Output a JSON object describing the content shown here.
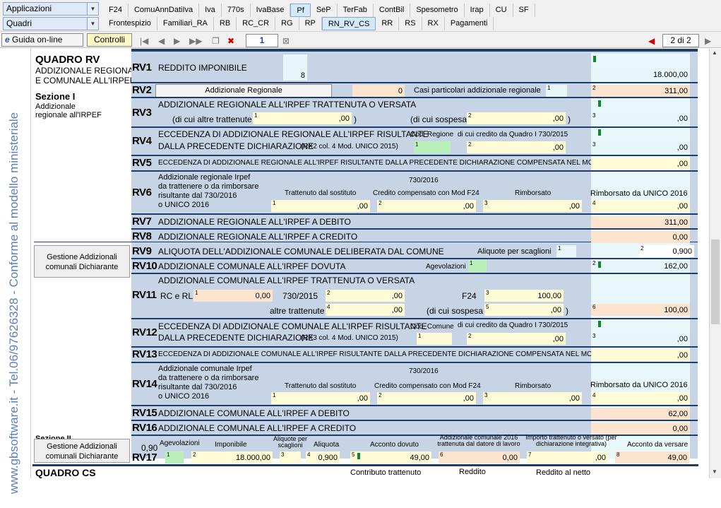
{
  "menus": {
    "applicazioni": "Applicazioni",
    "quadri": "Quadri"
  },
  "tabs_row1": [
    "F24",
    "ComuAnnDatiIva",
    "Iva",
    "770s",
    "IvaBase",
    "Pf",
    "SeP",
    "TerFab",
    "ContBil",
    "Spesometro",
    "Irap",
    "CU",
    "SF"
  ],
  "tabs_row2": [
    "Frontespizio",
    "Familiari_RA",
    "RB",
    "RC_CR",
    "RG",
    "RP",
    "RN_RV_CS",
    "RR",
    "RS",
    "RX",
    "Pagamenti"
  ],
  "toolbar": {
    "guida": "Guida on-line",
    "controlli": "Controlli",
    "page_box": "1",
    "page_of": "2 di 2"
  },
  "side_text": "www.gbsoftware.it - Tel.06/97626328 - Conforme al modello ministeriale",
  "quadro": {
    "title": "QUADRO RV",
    "sub1": "ADDIZIONALE REGIONALE",
    "sub2": "E COMUNALE ALL'IRPEF",
    "sezione": "Sezione I",
    "sez_sub1": "Addizionale",
    "sez_sub2": "regionale all'IRPEF",
    "next_title": "QUADRO CS",
    "sez2": "Sezione II"
  },
  "buttons": {
    "gestione1": "Gestione Addizionali comunali Dichiarante",
    "gestione2": "Gestione Addizionali comunali Dichiarante"
  },
  "rows": {
    "rv1": {
      "code": "RV1",
      "label": "REDDITO IMPONIBILE",
      "v1": "8",
      "v2": "18.000",
      "dec": ",00"
    },
    "rv2": {
      "code": "RV2",
      "btn": "Addizionale Regionale",
      "v0": "0",
      "label": "Casi particolari addizionale regionale",
      "v2": "311",
      "dec": ",00"
    },
    "rv3": {
      "code": "RV3",
      "label": "ADDIZIONALE REGIONALE ALL'IRPEF TRATTENUTA O VERSATA",
      "l1": "(di cui altre trattenute",
      "l2": "(di cui sospesa",
      "dec": ",00"
    },
    "rv4": {
      "code": "RV4",
      "label": "ECCEDENZA DI ADDIZIONALE REGIONALE ALL'IRPEF RISULTANTE",
      "label2": "DALLA PRECEDENTE DICHIARAZIONE",
      "small": "(RX2 col. 4  Mod. UNICO 2015)",
      "cod": "Cod. Regione",
      "cred": "di cui credito da Quadro I 730/2015",
      "dec": ",00"
    },
    "rv5": {
      "code": "RV5",
      "label": "ECCEDENZA DI ADDIZIONALE REGIONALE ALL'IRPEF RISULTANTE DALLA PRECEDENTE DICHIARAZIONE COMPENSATA NEL MOD. F24",
      "dec": ",00"
    },
    "rv6": {
      "code": "RV6",
      "l1": "Addizionale regionale Irpef",
      "l2": "da trattenere o da rimborsare",
      "l3": "risultante dal 730/2016",
      "l4": "o UNICO 2016",
      "h": "730/2016",
      "c1": "Trattenuto dal sostituto",
      "c2": "Credito compensato con Mod F24",
      "c3": "Rimborsato",
      "c4": "Rimborsato da UNICO 2016",
      "dec": ",00"
    },
    "rv7": {
      "code": "RV7",
      "label": "ADDIZIONALE REGIONALE ALL'IRPEF A DEBITO",
      "v": "311",
      "dec": ",00"
    },
    "rv8": {
      "code": "RV8",
      "label": "ADDIZIONALE REGIONALE ALL'IRPEF A CREDITO",
      "v": "0",
      "dec": ",00",
      "extra": "0"
    },
    "rv9": {
      "code": "RV9",
      "label": "ALIQUOTA DELL'ADDIZIONALE COMUNALE DELIBERATA DAL COMUNE",
      "sc": "Aliquote per scaglioni",
      "v": "0,900"
    },
    "rv10": {
      "code": "RV10",
      "label": "ADDIZIONALE COMUNALE ALL'IRPEF DOVUTA",
      "ag": "Agevolazioni",
      "v": "162",
      "dec": ",00"
    },
    "rv11": {
      "code": "RV11",
      "label": "ADDIZIONALE COMUNALE ALL'IRPEF TRATTENUTA O VERSATA",
      "rc": "RC e RL",
      "v1": "0",
      "l730": "730/2015",
      "f24": "F24",
      "v3": "100",
      "alt": "altre trattenute",
      "sosp": "(di cui sospesa",
      "v6": "100",
      "dec": ",00"
    },
    "rv12": {
      "code": "RV12",
      "label": "ECCEDENZA DI ADDIZIONALE COMUNALE ALL'IRPEF RISULTANTE",
      "label2": "DALLA PRECEDENTE DICHIARAZIONE",
      "small": "(RX3 col. 4  Mod. UNICO 2015)",
      "cod": "Cod. Comune",
      "cred": "di cui credito da Quadro I 730/2015",
      "dec": ",00"
    },
    "rv13": {
      "code": "RV13",
      "label": "ECCEDENZA DI ADDIZIONALE COMUNALE ALL'IRPEF RISULTANTE DALLA PRECEDENTE DICHIARAZIONE COMPENSATA NEL MOD. F24",
      "dec": ",00"
    },
    "rv14": {
      "code": "RV14",
      "l1": "Addizionale comunale Irpef",
      "l2": "da trattenere o da rimborsare",
      "l3": "risultante dal 730/2016",
      "l4": "o UNICO 2016",
      "h": "730/2016",
      "c1": "Trattenuto dal sostituto",
      "c2": "Credito compensato con Mod F24",
      "c3": "Rimborsato",
      "c4": "Rimborsato da UNICO 2016",
      "dec": ",00"
    },
    "rv15": {
      "code": "RV15",
      "label": "ADDIZIONALE COMUNALE ALL'IRPEF A DEBITO",
      "v": "62",
      "dec": ",00"
    },
    "rv16": {
      "code": "RV16",
      "label": "ADDIZIONALE COMUNALE ALL'IRPEF A CREDITO",
      "v": "0",
      "dec": ",00"
    },
    "rv17": {
      "code": "RV17",
      "pre": "0,90",
      "h1": "Agevolazioni",
      "h2": "Imponibile",
      "h3": "Aliquote per scaglioni",
      "h4": "Aliquota",
      "h5": "Acconto dovuto",
      "h6": "Addizionale comunale 2016 trattenuta dal datore di lavoro",
      "h7": "Importo trattenuto o versato (per dichiarazione integrativa)",
      "h8": "Acconto da versare",
      "v2": "18.000",
      "v4": "0,900",
      "v5": "49",
      "v6": "0",
      "v8": "49",
      "dec": ",00"
    },
    "cs": {
      "c1": "Contributo trattenuto",
      "c2": "Reddito",
      "c3": "Reddito al netto"
    }
  }
}
